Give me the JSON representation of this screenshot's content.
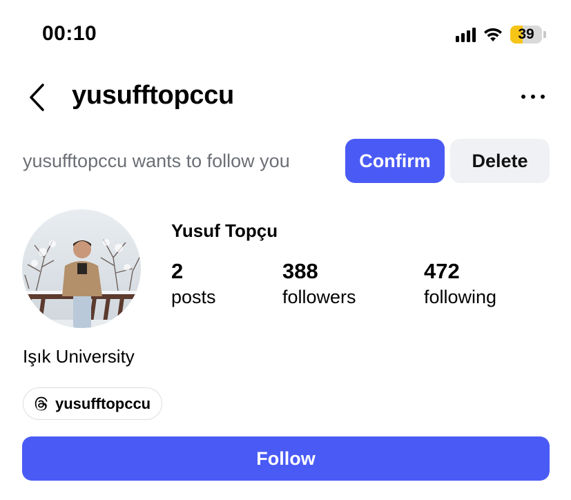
{
  "status_bar": {
    "time": "00:10",
    "battery_level": "39",
    "battery_color": "#f5c518",
    "signal_icon": "cellular-signal-icon",
    "wifi_icon": "wifi-icon"
  },
  "header": {
    "back_icon": "chevron-left-icon",
    "username": "yusufftopccu",
    "more_icon": "more-horizontal-icon"
  },
  "follow_request": {
    "message": "yusufftopccu wants to follow you",
    "confirm_label": "Confirm",
    "delete_label": "Delete"
  },
  "profile": {
    "full_name": "Yusuf Topçu",
    "stats": {
      "posts": {
        "value": "2",
        "label": "posts"
      },
      "followers": {
        "value": "388",
        "label": "followers"
      },
      "following": {
        "value": "472",
        "label": "following"
      }
    },
    "bio": "Işık University",
    "threads": {
      "icon": "threads-icon",
      "handle": "yusufftopccu"
    }
  },
  "actions": {
    "follow_label": "Follow"
  },
  "colors": {
    "accent": "#4a5bf5",
    "secondary_button": "#eff1f4",
    "muted_text": "#6b6f75"
  }
}
